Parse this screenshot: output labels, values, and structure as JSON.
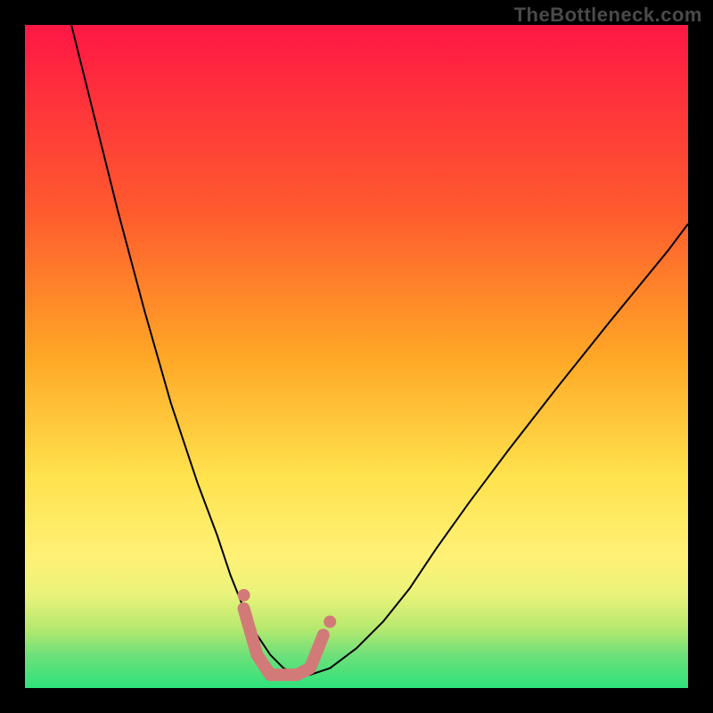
{
  "watermark": "TheBottleneck.com",
  "chart_data": {
    "type": "line",
    "title": "",
    "xlabel": "",
    "ylabel": "",
    "xlim": [
      0,
      100
    ],
    "ylim": [
      0,
      100
    ],
    "background_gradient_stops": [
      {
        "offset": 0,
        "color": "#ff1744"
      },
      {
        "offset": 28,
        "color": "#ff5a2e"
      },
      {
        "offset": 50,
        "color": "#ffa726"
      },
      {
        "offset": 68,
        "color": "#ffe24d"
      },
      {
        "offset": 80,
        "color": "#fff176"
      },
      {
        "offset": 86,
        "color": "#e9f27a"
      },
      {
        "offset": 91,
        "color": "#b6e96e"
      },
      {
        "offset": 95,
        "color": "#6fe07a"
      },
      {
        "offset": 100,
        "color": "#2ee27b"
      }
    ],
    "series": [
      {
        "name": "curve",
        "color": "#000000",
        "width": 2,
        "x": [
          7,
          10,
          14,
          18,
          22,
          26,
          29,
          31,
          33,
          35,
          37,
          39,
          41,
          43,
          46,
          50,
          54,
          58,
          62,
          67,
          73,
          80,
          88,
          97,
          100
        ],
        "y": [
          100,
          88,
          72,
          57,
          43,
          31,
          23,
          17,
          12,
          8,
          5,
          3,
          2,
          2,
          3,
          6,
          10,
          15,
          21,
          28,
          36,
          45,
          55,
          66,
          70
        ]
      },
      {
        "name": "bottom-highlight",
        "color": "#d27a78",
        "width": 14,
        "linecap": "round",
        "x": [
          33,
          35,
          37,
          39,
          41,
          43,
          45
        ],
        "y": [
          12,
          5,
          2,
          2,
          2,
          3,
          8
        ],
        "endpoints": [
          {
            "x": 33,
            "y": 14
          },
          {
            "x": 46,
            "y": 10
          }
        ]
      }
    ]
  }
}
